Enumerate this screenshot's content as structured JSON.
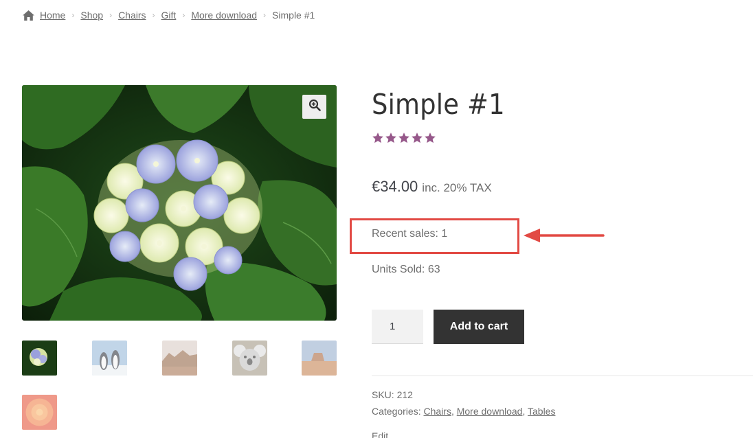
{
  "breadcrumb": {
    "items": [
      "Home",
      "Shop",
      "Chairs",
      "Gift",
      "More download"
    ],
    "current": "Simple #1",
    "separator": "›"
  },
  "product": {
    "title": "Simple #1",
    "rating": {
      "value": 5,
      "max": 5,
      "color": "#96588a"
    },
    "price": "€34.00",
    "price_suffix": "inc. 20% TAX",
    "recent_sales": "Recent sales: 1",
    "units_sold": "Units Sold: 63",
    "quantity": "1",
    "add_to_cart_label": "Add to cart",
    "sku_label": "SKU:",
    "sku_value": "212",
    "categories_label": "Categories:",
    "categories": [
      "Chairs",
      "More download",
      "Tables"
    ],
    "edit_label": "Edit"
  },
  "gallery": {
    "main_image": "hydrangea",
    "thumbnails": [
      "hydrangea",
      "penguins",
      "desert",
      "koala",
      "lighthouse-mesa",
      "chrysanthemum"
    ]
  },
  "annotation": {
    "box_color": "#e24a44",
    "arrow_color": "#e24a44"
  },
  "colors": {
    "button_bg": "#333333",
    "star": "#96588a",
    "text": "#6d6d6d"
  }
}
